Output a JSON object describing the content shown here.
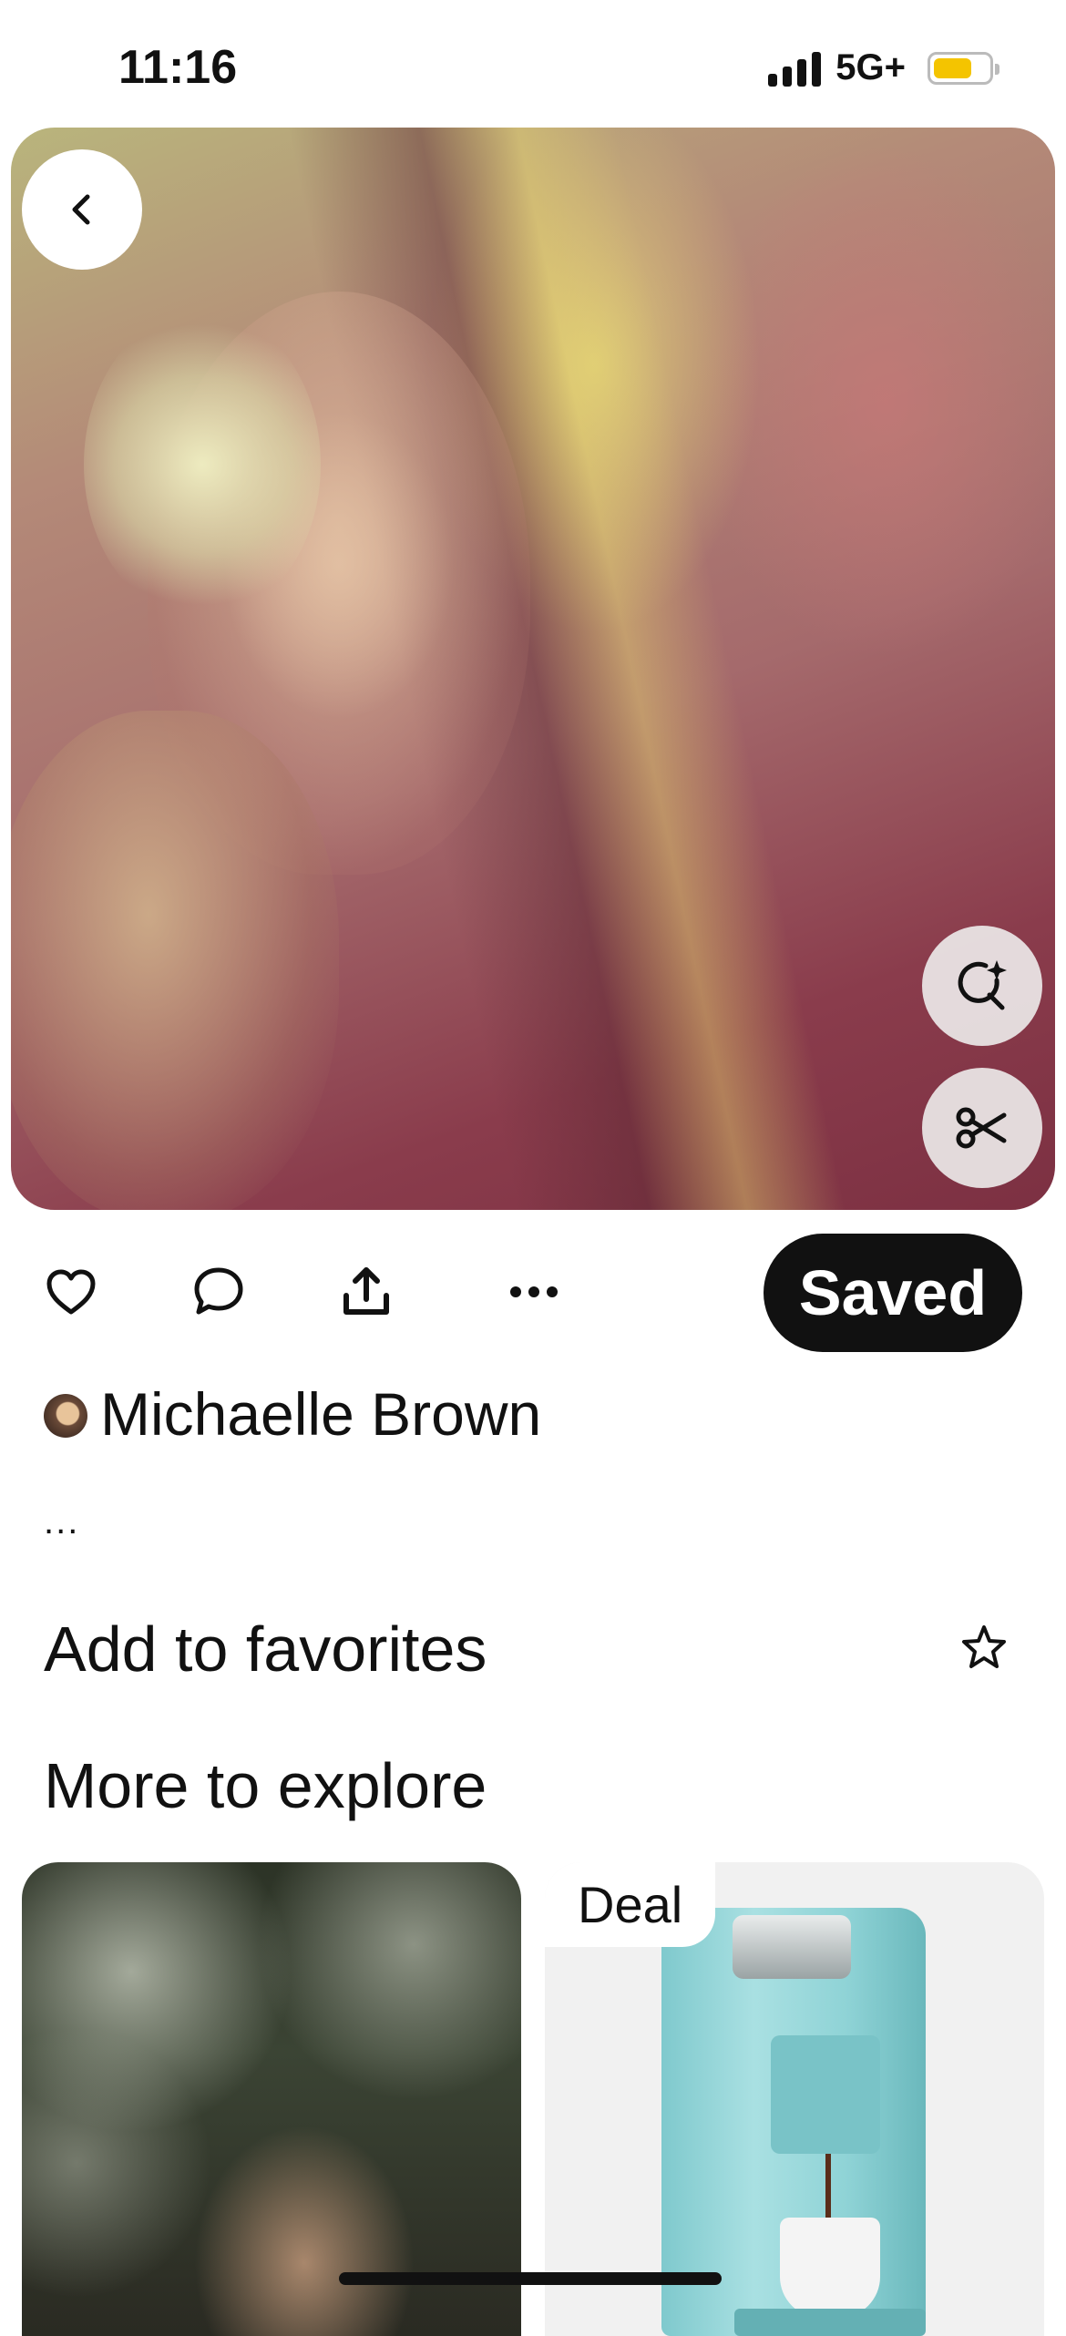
{
  "status_bar": {
    "time": "11:16",
    "network": "5G+",
    "battery_color": "#f4c400",
    "battery_level": 0.7
  },
  "pin": {
    "image_icon_names": {
      "back": "chevron-left-icon",
      "visual_search": "visual-search-icon",
      "cutout": "scissors-icon"
    }
  },
  "actions": {
    "icons": [
      "heart-icon",
      "comment-icon",
      "share-icon",
      "more-icon"
    ],
    "saved_label": "Saved"
  },
  "creator": {
    "name": "Michaelle Brown"
  },
  "description_more": "...",
  "favorites": {
    "label": "Add to favorites",
    "icon": "star-icon"
  },
  "explore": {
    "title": "More to explore",
    "cards": [
      {
        "badge": ""
      },
      {
        "badge": "Deal"
      }
    ]
  },
  "colors": {
    "saved_button_bg": "#111111",
    "text": "#111111"
  }
}
